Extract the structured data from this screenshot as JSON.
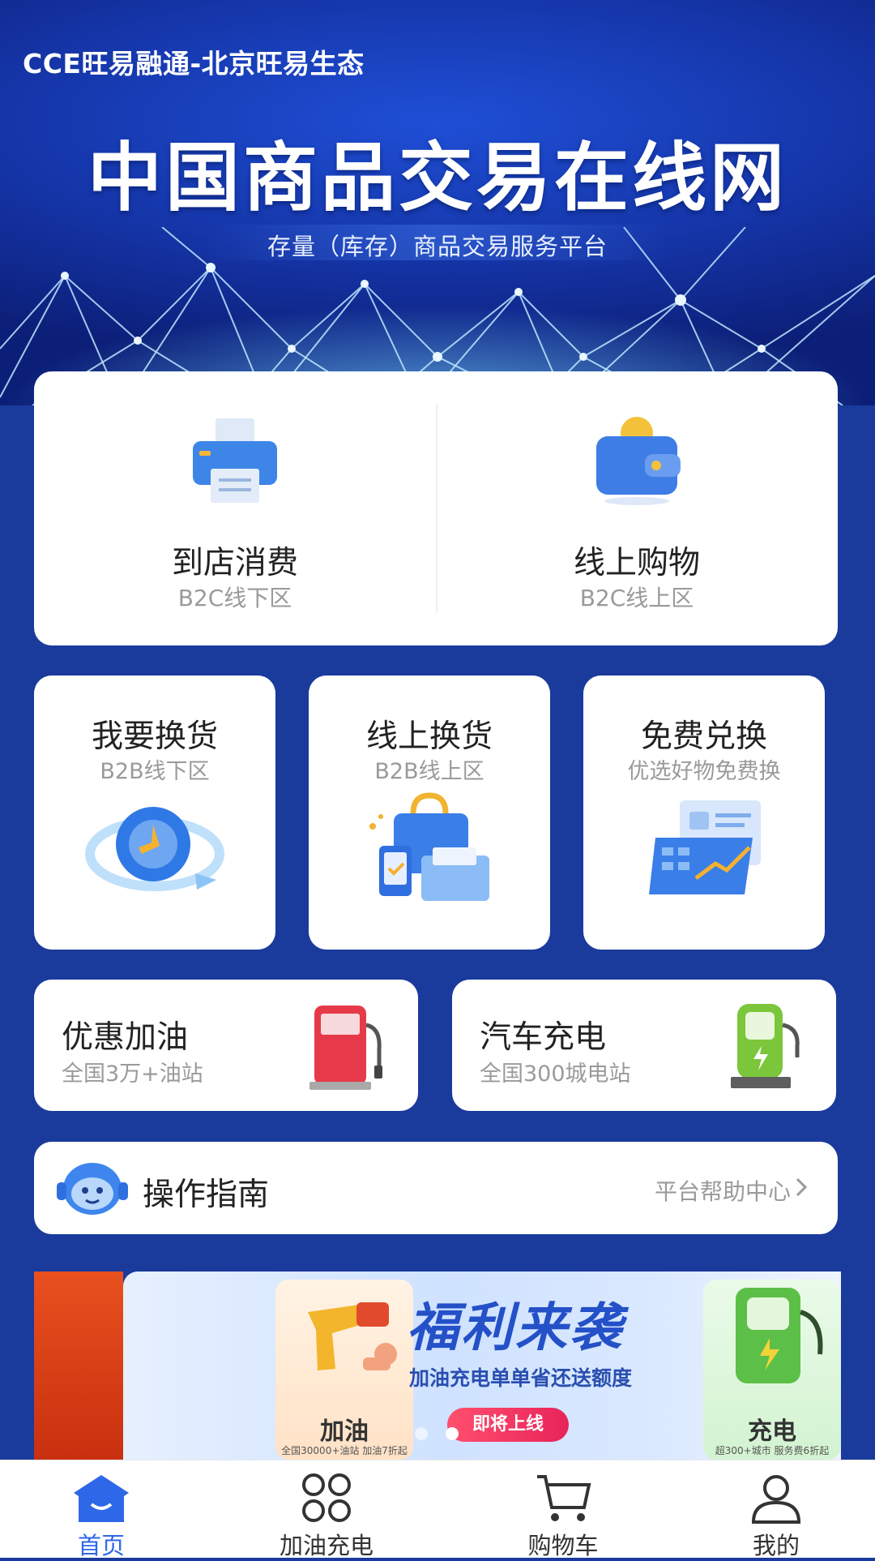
{
  "app": {
    "name": "CCE旺易融通-北京旺易生态"
  },
  "hero": {
    "title": "中国商品交易在线网",
    "subtitle": "存量（库存）商品交易服务平台"
  },
  "main_services": [
    {
      "title": "到店消费",
      "subtitle": "B2C线下区",
      "icon": "printer-icon"
    },
    {
      "title": "线上购物",
      "subtitle": "B2C线上区",
      "icon": "wallet-icon"
    }
  ],
  "exchange_services": [
    {
      "title": "我要换货",
      "subtitle": "B2B线下区",
      "icon": "exchange-clock-icon"
    },
    {
      "title": "线上换货",
      "subtitle": "B2B线上区",
      "icon": "shopping-bag-icon"
    },
    {
      "title": "免费兑换",
      "subtitle": "优选好物免费换",
      "icon": "chart-report-icon"
    }
  ],
  "energy_services": [
    {
      "title": "优惠加油",
      "subtitle": "全国3万+油站",
      "icon": "gas-pump-icon",
      "color": "#e63a4a"
    },
    {
      "title": "汽车充电",
      "subtitle": "全国300城电站",
      "icon": "ev-charger-icon",
      "color": "#7bc63a"
    }
  ],
  "guide": {
    "title": "操作指南",
    "link": "平台帮助中心",
    "icon": "robot-support-icon"
  },
  "promo": {
    "headline": "福利来袭",
    "line": "加油充电单单省还送额度",
    "button": "即将上线",
    "left_card": {
      "label": "加油",
      "note": "全国30000+油站 加油7折起"
    },
    "right_card": {
      "label": "充电",
      "note": "超300+城市 服务费6折起"
    }
  },
  "bottom_nav": [
    {
      "label": "首页",
      "icon": "home-icon",
      "active": true
    },
    {
      "label": "加油充电",
      "icon": "grid-icon",
      "active": false
    },
    {
      "label": "购物车",
      "icon": "cart-icon",
      "active": false
    },
    {
      "label": "我的",
      "icon": "person-icon",
      "active": false
    }
  ],
  "colors": {
    "background": "#1a3a9c",
    "accent": "#2e67e8",
    "card": "#ffffff"
  }
}
